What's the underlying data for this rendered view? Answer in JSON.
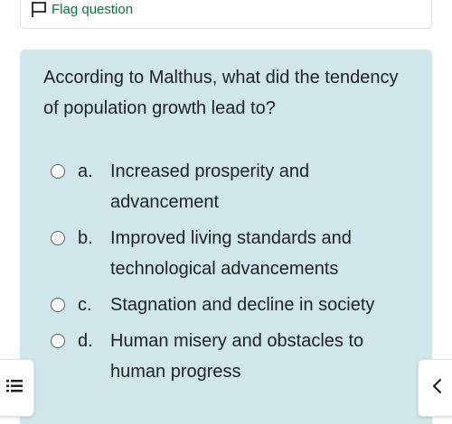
{
  "flag": {
    "label": "Flag question",
    "icon": "flag-icon",
    "color": "#0f6e3f"
  },
  "question": {
    "text": "According to Malthus, what did the tendency of population growth lead to?",
    "background": "#cfe6ea"
  },
  "answers": [
    {
      "letter": "a.",
      "label": "Increased prosperity and advancement"
    },
    {
      "letter": "b.",
      "label": "Improved living standards and technological advancements"
    },
    {
      "letter": "c.",
      "label": "Stagnation and decline in society"
    },
    {
      "letter": "d.",
      "label": "Human misery and obstacles to human progress"
    }
  ],
  "drawers": {
    "left_icon": "list-icon",
    "right_icon": "chevron-left-icon"
  }
}
